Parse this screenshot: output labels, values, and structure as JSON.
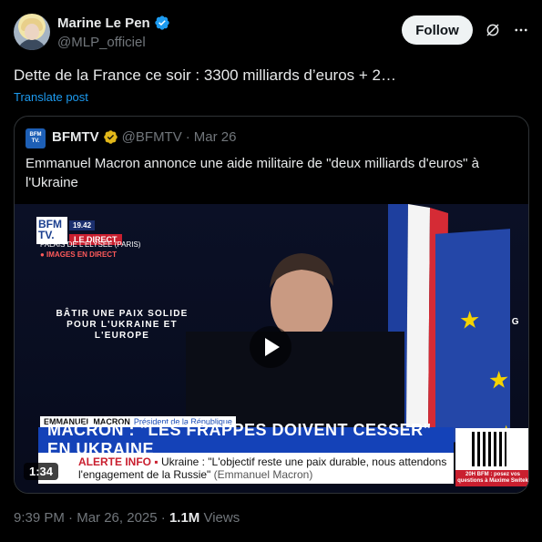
{
  "author": {
    "name": "Marine Le Pen",
    "handle": "@MLP_officiel",
    "avatar_icon": "avatar-photo"
  },
  "actions": {
    "follow_label": "Follow",
    "grok_icon": "grok-icon",
    "more_icon": "more-icon"
  },
  "post": {
    "text": "Dette de la France ce soir : 3300 milliards d’euros + 2…",
    "translate_label": "Translate post"
  },
  "quote": {
    "logo_top": "BFM",
    "logo_bottom": "TV.",
    "name": "BFMTV",
    "handle": "@BFMTV",
    "separator": "·",
    "date": "Mar 26",
    "text": "Emmanuel Macron annonce une aide militaire de \"deux milliards d'euros\" à l'Ukraine",
    "video": {
      "duration": "1:34",
      "badge_line1": "BFM",
      "badge_line2": "TV.",
      "live_time": "19.42",
      "live_label": "LE DIRECT",
      "place": "PALAIS DE L'ÉLYSÉE (PARIS)",
      "images_label": "● IMAGES EN DIRECT",
      "slogan": "BÂTIR UNE PAIX SOLIDE POUR L'UKRAINE ET L'EUROPE",
      "slogan_right": "TING",
      "speaker_name": "EMMANUEL MACRON",
      "speaker_role": "Président de la République",
      "headline": "MACRON : \"LES FRAPPES DOIVENT CESSER\" EN UKRAINE",
      "alerte": "ALERTE INFO ▪",
      "ticker_text": "Ukraine : \"L'objectif reste une paix durable, nous attendons l'engagement de la Russie\"",
      "ticker_source": "(Emmanuel Macron)",
      "qr_caption": "20H BFM : posez vos questions à Maxime Switek"
    }
  },
  "meta": {
    "time": "9:39 PM",
    "date": "Mar 26, 2025",
    "views_count": "1.1M",
    "views_label": "Views",
    "separator": "·"
  },
  "colors": {
    "background": "#000000",
    "link": "#1d9bf0",
    "verified_blue": "#1d9bf0",
    "verified_gold": "#e2b719",
    "muted": "#71767b"
  }
}
